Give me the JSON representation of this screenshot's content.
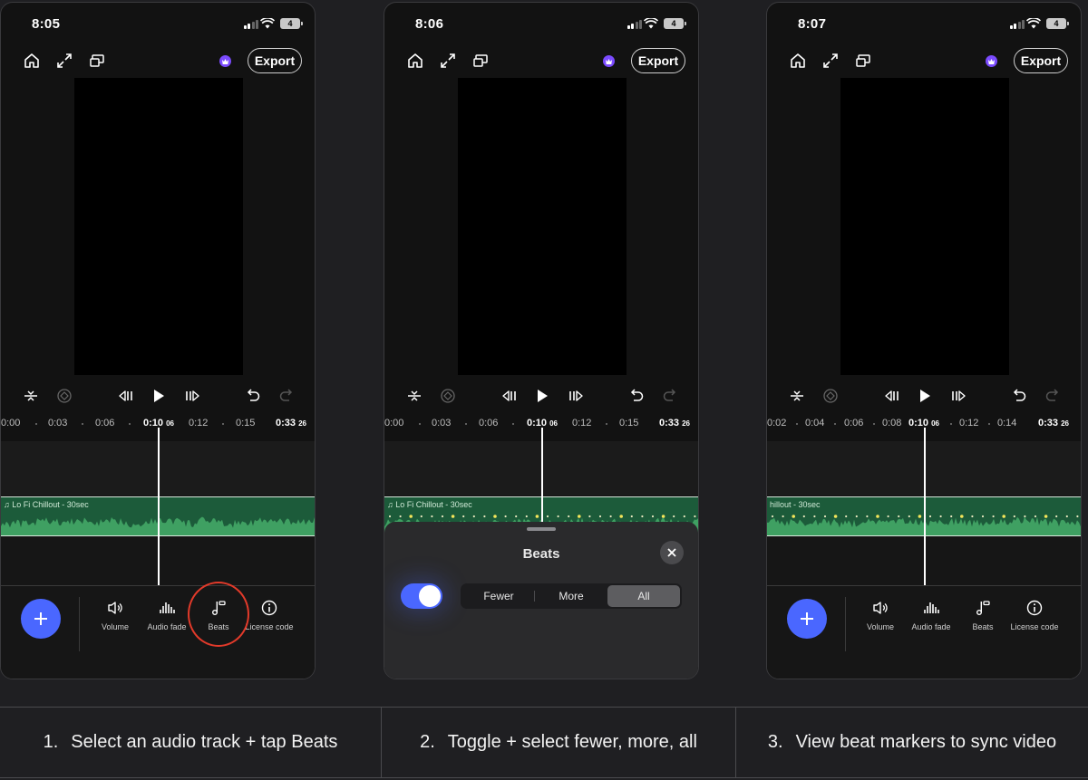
{
  "panels": [
    {
      "status": {
        "time": "8:05",
        "battery": "4"
      },
      "header": {
        "export_label": "Export"
      },
      "timeline": {
        "ticks": [
          "0:00",
          "0:03",
          "0:06",
          "0:12",
          "0:15"
        ],
        "current_time": "0:10",
        "current_frame": "06",
        "end_time": "0:33",
        "end_frame": "26"
      },
      "audio_track": {
        "title": "♫ Lo Fi Chillout - 30sec"
      },
      "toolbar": {
        "tools": [
          "Volume",
          "Audio fade",
          "Beats",
          "License code"
        ],
        "highlighted": "Beats"
      }
    },
    {
      "status": {
        "time": "8:06",
        "battery": "4"
      },
      "header": {
        "export_label": "Export"
      },
      "timeline": {
        "ticks": [
          "0:00",
          "0:03",
          "0:06",
          "0:12",
          "0:15"
        ],
        "current_time": "0:10",
        "current_frame": "06",
        "end_time": "0:33",
        "end_frame": "26"
      },
      "audio_track": {
        "title": "♫ Lo Fi Chillout - 30sec"
      },
      "beats_sheet": {
        "title": "Beats",
        "toggle_on": true,
        "options": [
          "Fewer",
          "More",
          "All"
        ],
        "selected": "All"
      }
    },
    {
      "status": {
        "time": "8:07",
        "battery": "4"
      },
      "header": {
        "export_label": "Export"
      },
      "timeline": {
        "ticks": [
          "0:02",
          "0:04",
          "0:06",
          "0:08",
          "0:12",
          "0:14"
        ],
        "current_time": "0:10",
        "current_frame": "06",
        "end_time": "0:33",
        "end_frame": "26"
      },
      "audio_track": {
        "title": "hillout - 30sec"
      },
      "toolbar": {
        "tools": [
          "Volume",
          "Audio fade",
          "Beats",
          "License code"
        ]
      }
    }
  ],
  "captions": [
    {
      "num": "1.",
      "text": "Select an audio track + tap Beats"
    },
    {
      "num": "2.",
      "text": "Toggle + select fewer, more, all"
    },
    {
      "num": "3.",
      "text": "View beat markers to sync video"
    }
  ],
  "colors": {
    "accent": "#4a67ff",
    "track_green": "#1c5b3a",
    "beat_marker": "#f5e65a",
    "highlight_ring": "#e23a2a",
    "premium": "#7b4bff"
  }
}
